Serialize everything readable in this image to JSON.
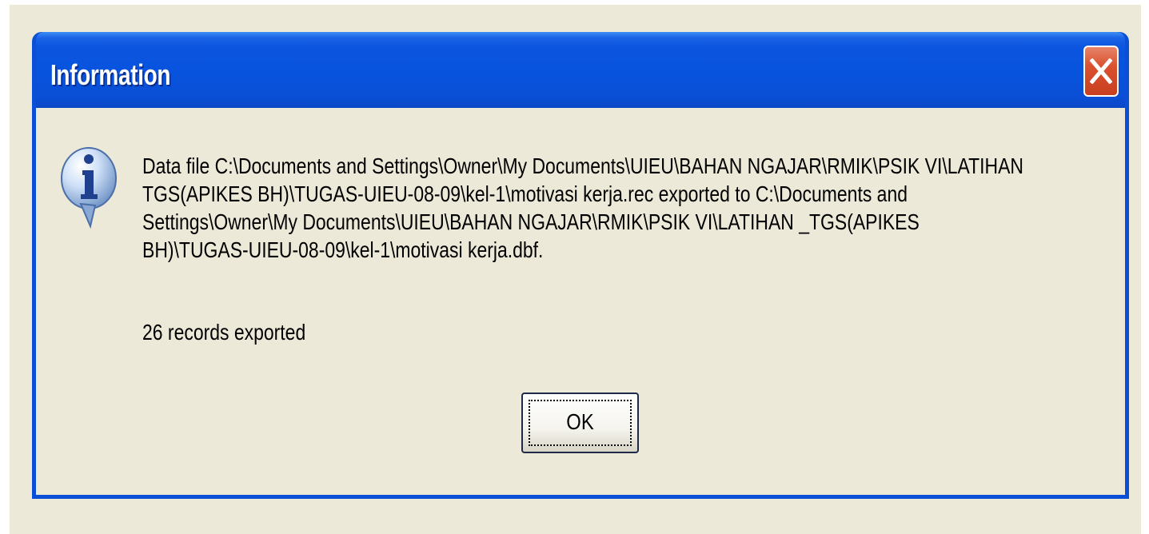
{
  "dialog": {
    "title": "Information",
    "close_glyph": "close-icon",
    "icon": "information-icon",
    "message_lines": [
      "Data file C:\\Documents and Settings\\Owner\\My Documents\\UIEU\\BAHAN NGAJAR\\RMIK\\PSIK VI\\LATIHAN",
      "TGS(APIKES BH)\\TUGAS-UIEU-08-09\\kel-1\\motivasi kerja.rec exported to C:\\Documents and",
      "Settings\\Owner\\My Documents\\UIEU\\BAHAN NGAJAR\\RMIK\\PSIK VI\\LATIHAN _TGS(APIKES",
      "BH)\\TUGAS-UIEU-08-09\\kel-1\\motivasi kerja.dbf."
    ],
    "records_text": "26 records exported",
    "ok_label": "OK"
  },
  "colors": {
    "titlebar": "#0a4fd6",
    "client_bg": "#ece9d8",
    "close_button": "#d9512f",
    "title_text": "#ffffff"
  }
}
